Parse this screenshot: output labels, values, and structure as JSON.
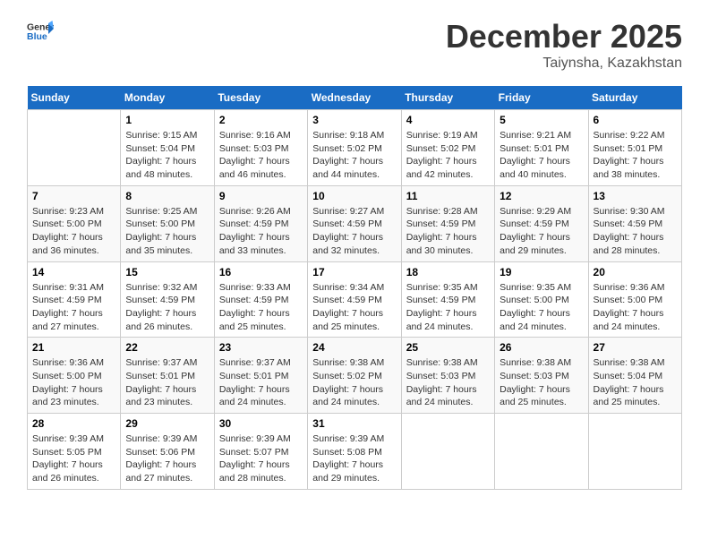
{
  "header": {
    "logo_general": "General",
    "logo_blue": "Blue",
    "title": "December 2025",
    "subtitle": "Taiynsha, Kazakhstan"
  },
  "days_of_week": [
    "Sunday",
    "Monday",
    "Tuesday",
    "Wednesday",
    "Thursday",
    "Friday",
    "Saturday"
  ],
  "weeks": [
    [
      {
        "day": "",
        "info": ""
      },
      {
        "day": "1",
        "info": "Sunrise: 9:15 AM\nSunset: 5:04 PM\nDaylight: 7 hours\nand 48 minutes."
      },
      {
        "day": "2",
        "info": "Sunrise: 9:16 AM\nSunset: 5:03 PM\nDaylight: 7 hours\nand 46 minutes."
      },
      {
        "day": "3",
        "info": "Sunrise: 9:18 AM\nSunset: 5:02 PM\nDaylight: 7 hours\nand 44 minutes."
      },
      {
        "day": "4",
        "info": "Sunrise: 9:19 AM\nSunset: 5:02 PM\nDaylight: 7 hours\nand 42 minutes."
      },
      {
        "day": "5",
        "info": "Sunrise: 9:21 AM\nSunset: 5:01 PM\nDaylight: 7 hours\nand 40 minutes."
      },
      {
        "day": "6",
        "info": "Sunrise: 9:22 AM\nSunset: 5:01 PM\nDaylight: 7 hours\nand 38 minutes."
      }
    ],
    [
      {
        "day": "7",
        "info": "Sunrise: 9:23 AM\nSunset: 5:00 PM\nDaylight: 7 hours\nand 36 minutes."
      },
      {
        "day": "8",
        "info": "Sunrise: 9:25 AM\nSunset: 5:00 PM\nDaylight: 7 hours\nand 35 minutes."
      },
      {
        "day": "9",
        "info": "Sunrise: 9:26 AM\nSunset: 4:59 PM\nDaylight: 7 hours\nand 33 minutes."
      },
      {
        "day": "10",
        "info": "Sunrise: 9:27 AM\nSunset: 4:59 PM\nDaylight: 7 hours\nand 32 minutes."
      },
      {
        "day": "11",
        "info": "Sunrise: 9:28 AM\nSunset: 4:59 PM\nDaylight: 7 hours\nand 30 minutes."
      },
      {
        "day": "12",
        "info": "Sunrise: 9:29 AM\nSunset: 4:59 PM\nDaylight: 7 hours\nand 29 minutes."
      },
      {
        "day": "13",
        "info": "Sunrise: 9:30 AM\nSunset: 4:59 PM\nDaylight: 7 hours\nand 28 minutes."
      }
    ],
    [
      {
        "day": "14",
        "info": "Sunrise: 9:31 AM\nSunset: 4:59 PM\nDaylight: 7 hours\nand 27 minutes."
      },
      {
        "day": "15",
        "info": "Sunrise: 9:32 AM\nSunset: 4:59 PM\nDaylight: 7 hours\nand 26 minutes."
      },
      {
        "day": "16",
        "info": "Sunrise: 9:33 AM\nSunset: 4:59 PM\nDaylight: 7 hours\nand 25 minutes."
      },
      {
        "day": "17",
        "info": "Sunrise: 9:34 AM\nSunset: 4:59 PM\nDaylight: 7 hours\nand 25 minutes."
      },
      {
        "day": "18",
        "info": "Sunrise: 9:35 AM\nSunset: 4:59 PM\nDaylight: 7 hours\nand 24 minutes."
      },
      {
        "day": "19",
        "info": "Sunrise: 9:35 AM\nSunset: 5:00 PM\nDaylight: 7 hours\nand 24 minutes."
      },
      {
        "day": "20",
        "info": "Sunrise: 9:36 AM\nSunset: 5:00 PM\nDaylight: 7 hours\nand 24 minutes."
      }
    ],
    [
      {
        "day": "21",
        "info": "Sunrise: 9:36 AM\nSunset: 5:00 PM\nDaylight: 7 hours\nand 23 minutes."
      },
      {
        "day": "22",
        "info": "Sunrise: 9:37 AM\nSunset: 5:01 PM\nDaylight: 7 hours\nand 23 minutes."
      },
      {
        "day": "23",
        "info": "Sunrise: 9:37 AM\nSunset: 5:01 PM\nDaylight: 7 hours\nand 24 minutes."
      },
      {
        "day": "24",
        "info": "Sunrise: 9:38 AM\nSunset: 5:02 PM\nDaylight: 7 hours\nand 24 minutes."
      },
      {
        "day": "25",
        "info": "Sunrise: 9:38 AM\nSunset: 5:03 PM\nDaylight: 7 hours\nand 24 minutes."
      },
      {
        "day": "26",
        "info": "Sunrise: 9:38 AM\nSunset: 5:03 PM\nDaylight: 7 hours\nand 25 minutes."
      },
      {
        "day": "27",
        "info": "Sunrise: 9:38 AM\nSunset: 5:04 PM\nDaylight: 7 hours\nand 25 minutes."
      }
    ],
    [
      {
        "day": "28",
        "info": "Sunrise: 9:39 AM\nSunset: 5:05 PM\nDaylight: 7 hours\nand 26 minutes."
      },
      {
        "day": "29",
        "info": "Sunrise: 9:39 AM\nSunset: 5:06 PM\nDaylight: 7 hours\nand 27 minutes."
      },
      {
        "day": "30",
        "info": "Sunrise: 9:39 AM\nSunset: 5:07 PM\nDaylight: 7 hours\nand 28 minutes."
      },
      {
        "day": "31",
        "info": "Sunrise: 9:39 AM\nSunset: 5:08 PM\nDaylight: 7 hours\nand 29 minutes."
      },
      {
        "day": "",
        "info": ""
      },
      {
        "day": "",
        "info": ""
      },
      {
        "day": "",
        "info": ""
      }
    ]
  ]
}
